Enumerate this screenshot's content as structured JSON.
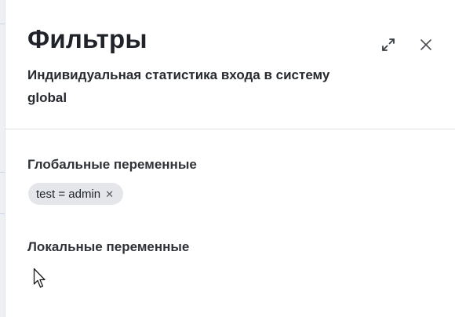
{
  "panel": {
    "title": "Фильтры",
    "subtitle": "Индивидуальная статистика входа в систему global",
    "expand_icon": "expand-arrows-icon",
    "close_icon": "close-icon"
  },
  "global_variables": {
    "title": "Глобальные переменные",
    "chips": [
      {
        "label": "test = admin",
        "remove_icon": "close-small-icon"
      }
    ]
  },
  "local_variables": {
    "title": "Локальные переменные"
  },
  "colors": {
    "background": "#ffffff",
    "chip_bg": "#e4e6ea",
    "text": "#1f2329",
    "divider": "#dcdfe4"
  }
}
